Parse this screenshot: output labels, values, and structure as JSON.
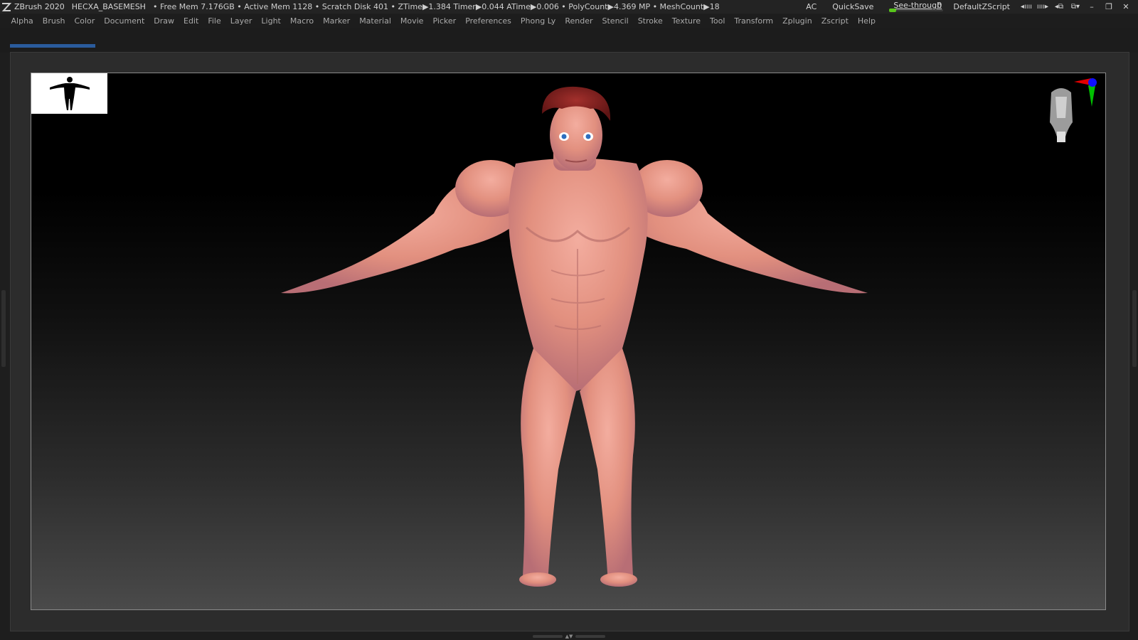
{
  "titlebar": {
    "app_name": "ZBrush 2020",
    "document": "HECXA_BASEMESH",
    "stats": "• Free Mem 7.176GB • Active Mem 1128 • Scratch Disk 401 •  ZTime▶1.384 Timer▶0.044 ATime▶0.006 • PolyCount▶4.369 MP  • MeshCount▶18",
    "ac": "AC",
    "quicksave": "QuickSave",
    "seethrough_label": "See-through",
    "seethrough_value": "0",
    "seethrough_level": 0,
    "zscript": "DefaultZScript"
  },
  "menu": [
    "Alpha",
    "Brush",
    "Color",
    "Document",
    "Draw",
    "Edit",
    "File",
    "Layer",
    "Light",
    "Macro",
    "Marker",
    "Material",
    "Movie",
    "Picker",
    "Preferences",
    "Phong Ly",
    "Render",
    "Stencil",
    "Stroke",
    "Texture",
    "Tool",
    "Transform",
    "Zplugin",
    "Zscript",
    "Help"
  ],
  "colors": {
    "accent_progress": "#2a5b9c",
    "seethrough_knob": "#58c51b",
    "skin": "#e89a8c",
    "hair": "#7a1e1e"
  },
  "icons": {
    "app_logo": "zbrush-logo-icon",
    "gizmo": "axis-gizmo-icon",
    "nav_head": "navigation-head-icon"
  }
}
